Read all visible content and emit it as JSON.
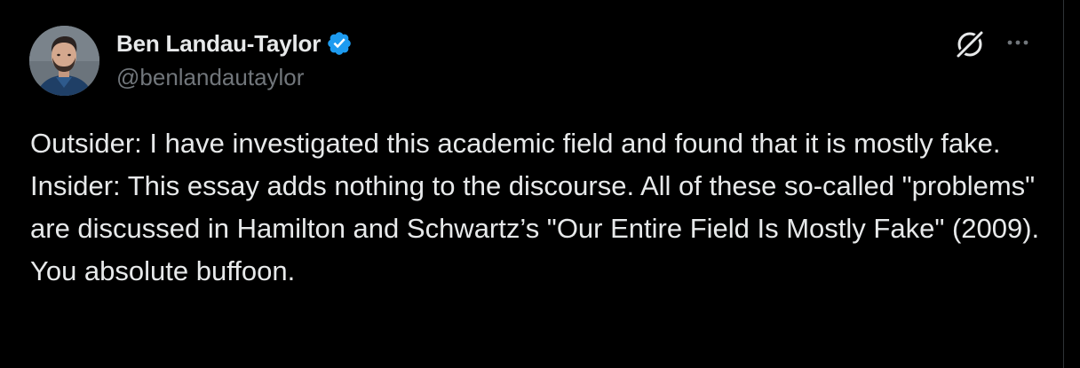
{
  "author": {
    "display_name": "Ben Landau-Taylor",
    "handle": "@benlandautaylor",
    "verified": true,
    "avatar_icon": "profile-photo"
  },
  "actions": {
    "grok_icon": "grok-icon",
    "more_icon": "more-options-icon"
  },
  "tweet": {
    "paragraphs": [
      "Outsider: I have investigated this academic field and found that it is mostly fake.",
      "Insider: This essay adds nothing to the discourse. All of these so-called \"problems\" are discussed in Hamilton and Schwartz’s \"Our Entire Field Is Mostly Fake\" (2009). You absolute buffoon."
    ]
  },
  "colors": {
    "background": "#000000",
    "text_primary": "#e7e9ea",
    "text_secondary": "#71767b",
    "verified_blue": "#1d9bf0"
  }
}
